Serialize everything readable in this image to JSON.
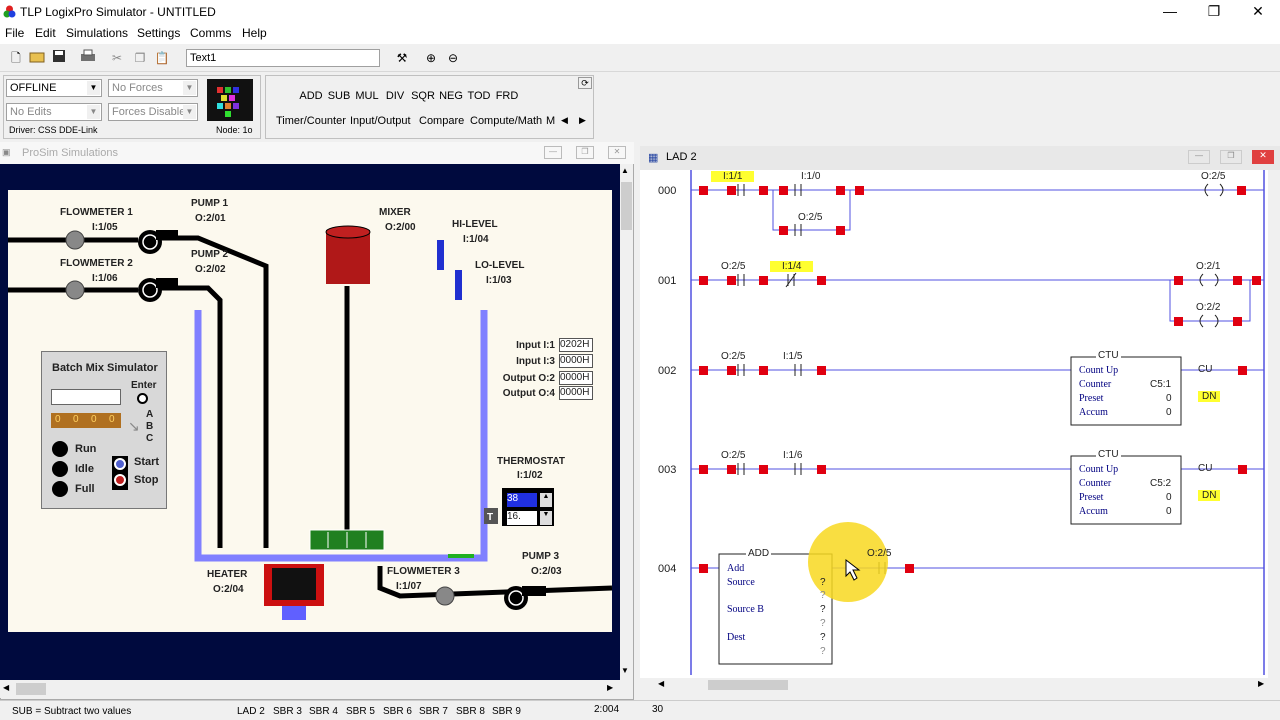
{
  "window": {
    "title": "TLP LogixPro Simulator  -  UNTITLED"
  },
  "menu": [
    "File",
    "Edit",
    "Simulations",
    "Settings",
    "Comms",
    "Help"
  ],
  "toolbar": {
    "text_field": "Text1"
  },
  "palette": {
    "mode": "OFFLINE",
    "forces": "No Forces",
    "edits": "No Edits",
    "forces_state": "Forces Disabled",
    "driver": "Driver: CSS DDE-Link",
    "node": "Node: 1o",
    "instructions": [
      "ADD",
      "SUB",
      "MUL",
      "DIV",
      "SQR",
      "NEG",
      "TOD",
      "FRD"
    ],
    "tabs": [
      "Timer/Counter",
      "Input/Output",
      "Compare",
      "Compute/Math",
      "M"
    ]
  },
  "prosim": {
    "title": "ProSim Simulations",
    "labels": {
      "fm1": "FLOWMETER 1",
      "fm1_addr": "I:1/05",
      "fm2": "FLOWMETER 2",
      "fm2_addr": "I:1/06",
      "pump1": "PUMP 1",
      "pump1_addr": "O:2/01",
      "pump2": "PUMP 2",
      "pump2_addr": "O:2/02",
      "mixer": "MIXER",
      "mixer_addr": "O:2/00",
      "hilevel": "HI-LEVEL",
      "hilevel_addr": "I:1/04",
      "lolevel": "LO-LEVEL",
      "lolevel_addr": "I:1/03",
      "thermostat": "THERMOSTAT",
      "thermostat_addr": "I:1/02",
      "heater": "HEATER",
      "heater_addr": "O:2/04",
      "fm3": "FLOWMETER 3",
      "fm3_addr": "I:1/07",
      "pump3": "PUMP 3",
      "pump3_addr": "O:2/03"
    },
    "io": [
      {
        "label": "Input I:1",
        "value": "0202H"
      },
      {
        "label": "Input I:3",
        "value": "0000H"
      },
      {
        "label": "Output O:2",
        "value": "0000H"
      },
      {
        "label": "Output O:4",
        "value": "0000H"
      }
    ],
    "batch": {
      "title": "Batch Mix Simulator",
      "enter": "Enter",
      "digits": [
        "0",
        "0",
        "0",
        "0"
      ],
      "abc": [
        "A",
        "B",
        "C"
      ],
      "run": "Run",
      "idle": "Idle",
      "full": "Full",
      "start": "Start",
      "stop": "Stop"
    },
    "thermo": {
      "set": "38",
      "actual": "16.",
      "t": "T"
    }
  },
  "lad": {
    "title": "LAD 2",
    "rungs": [
      "000",
      "001",
      "002",
      "003",
      "004"
    ],
    "r0": {
      "a": "I:1/1",
      "b": "I:1/0",
      "c": "O:2/5",
      "coil": "O:2/5"
    },
    "r1": {
      "a": "O:2/5",
      "b": "I:1/4",
      "coil1": "O:2/1",
      "coil2": "O:2/2"
    },
    "r2": {
      "a": "O:2/5",
      "b": "I:1/5"
    },
    "r3": {
      "a": "O:2/5",
      "b": "I:1/6"
    },
    "ctu": {
      "title": "CTU",
      "name": "Count Up",
      "counter": "Counter",
      "preset": "Preset",
      "accum": "Accum",
      "c1": "C5:1",
      "c2": "C5:2",
      "pv": "0",
      "av": "0",
      "cu": "CU",
      "dn": "DN"
    },
    "add": {
      "title": "ADD",
      "name": "Add",
      "src": "Source",
      "srcb": "Source B",
      "dest": "Dest",
      "q": "?",
      "contact": "O:2/5"
    }
  },
  "status": {
    "hint": "SUB = Subtract two values",
    "tabs": [
      "LAD 2",
      "SBR 3",
      "SBR 4",
      "SBR 5",
      "SBR 6",
      "SBR 7",
      "SBR 8",
      "SBR 9"
    ],
    "pos": "2:004",
    "num": "30"
  }
}
